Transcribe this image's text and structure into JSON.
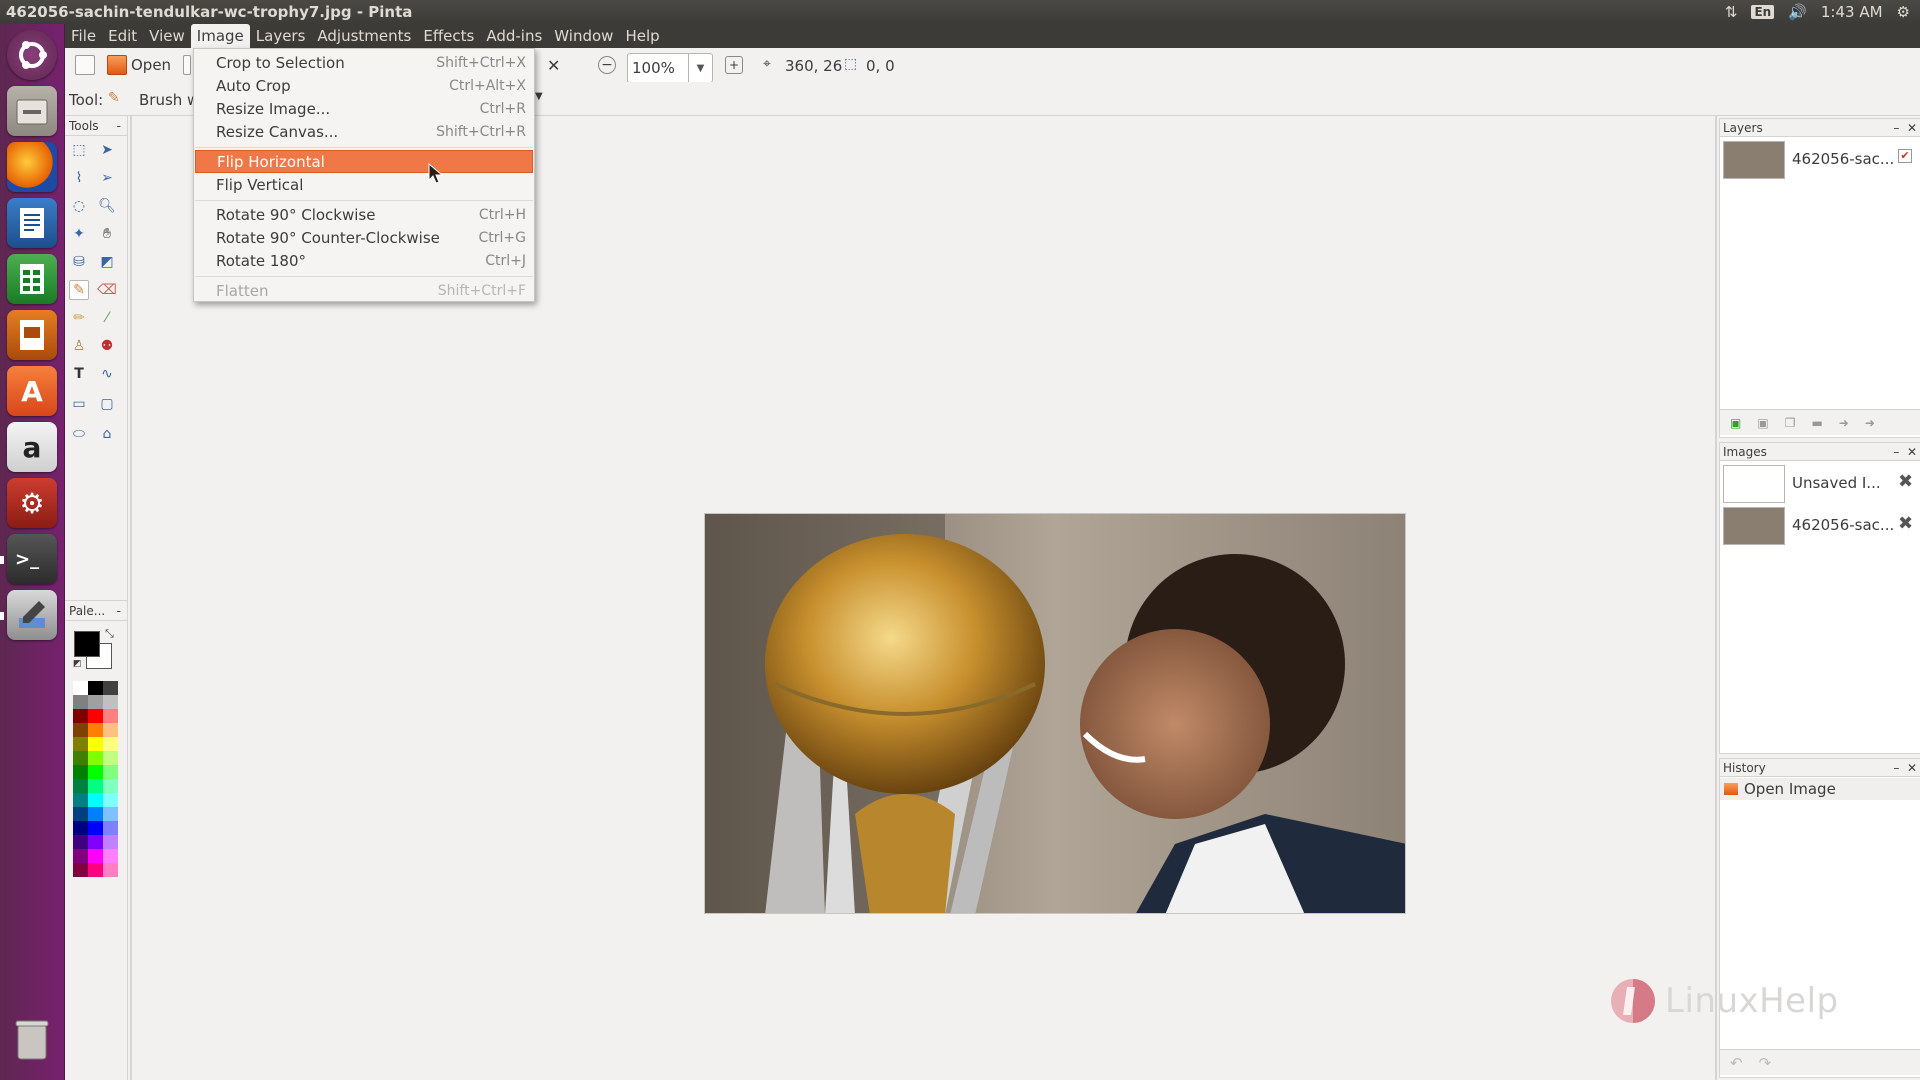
{
  "window": {
    "title": "462056-sachin-tendulkar-wc-trophy7.jpg - Pinta"
  },
  "tray": {
    "keyboard": "En",
    "time": "1:43 AM"
  },
  "menubar": {
    "items": [
      "File",
      "Edit",
      "View",
      "Image",
      "Layers",
      "Adjustments",
      "Effects",
      "Add-ins",
      "Window",
      "Help"
    ],
    "active": "Image"
  },
  "toolbar": {
    "open_label": "Open",
    "tool_label": "Tool:",
    "brush_label": "Brush w",
    "zoom_value": "100%",
    "cursor_position": "360, 26",
    "selection_size": "0, 0"
  },
  "image_menu": {
    "items": [
      {
        "label": "Crop to Selection",
        "shortcut": "Shift+Ctrl+X"
      },
      {
        "label": "Auto Crop",
        "shortcut": "Ctrl+Alt+X"
      },
      {
        "label": "Resize Image...",
        "shortcut": "Ctrl+R"
      },
      {
        "label": "Resize Canvas...",
        "shortcut": "Shift+Ctrl+R"
      },
      {
        "label": "Flip Horizontal",
        "shortcut": ""
      },
      {
        "label": "Flip Vertical",
        "shortcut": ""
      },
      {
        "label": "Rotate 90° Clockwise",
        "shortcut": "Ctrl+H"
      },
      {
        "label": "Rotate 90° Counter-Clockwise",
        "shortcut": "Ctrl+G"
      },
      {
        "label": "Rotate 180°",
        "shortcut": "Ctrl+J"
      },
      {
        "label": "Flatten",
        "shortcut": "Shift+Ctrl+F"
      }
    ],
    "highlighted": "Flip Horizontal",
    "disabled": [
      "Flatten"
    ]
  },
  "panels": {
    "tools_title": "Tools",
    "palette_title": "Pale...",
    "layers": {
      "title": "Layers",
      "layer_name": "462056-sac..."
    },
    "images": {
      "title": "Images",
      "items": [
        "Unsaved I...",
        "462056-sac..."
      ]
    },
    "history": {
      "title": "History",
      "items": [
        "Open Image"
      ]
    }
  },
  "palette_colors": [
    "#ffffff",
    "#000000",
    "#404040",
    "#808080",
    "#a0a0a0",
    "#c0c0c0",
    "#800000",
    "#ff0000",
    "#ff8080",
    "#804000",
    "#ff8000",
    "#ffc080",
    "#808000",
    "#ffff00",
    "#ffff80",
    "#408000",
    "#80ff00",
    "#c0ff80",
    "#008000",
    "#00ff00",
    "#80ff80",
    "#008040",
    "#00ff80",
    "#80ffc0",
    "#008080",
    "#00ffff",
    "#80ffff",
    "#004080",
    "#0080ff",
    "#80c0ff",
    "#000080",
    "#0000ff",
    "#8080ff",
    "#400080",
    "#8000ff",
    "#c080ff",
    "#800080",
    "#ff00ff",
    "#ff80ff",
    "#800040",
    "#ff0080",
    "#ff80c0"
  ],
  "watermark": {
    "text": "LinuxHelp"
  },
  "colors": {
    "highlight": "#f07746",
    "launcher": "#77216f",
    "panel": "#3c3b37"
  }
}
